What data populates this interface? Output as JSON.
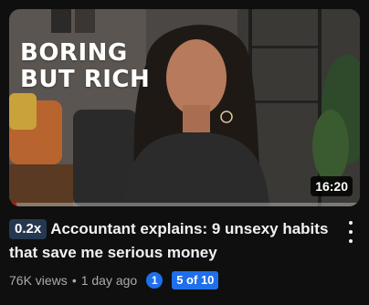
{
  "video": {
    "thumbnail_text_line1": "BORING",
    "thumbnail_text_line2": "BUT RICH",
    "duration": "16:20",
    "watch_progress_percent": 2,
    "playback_speed": "0.2x",
    "title": "Accountant explains: 9 unsexy habits that save me serious money",
    "views": "76K views",
    "separator": "•",
    "age": "1 day ago",
    "count_badge": "1",
    "position_badge": "5 of 10"
  },
  "icons": {
    "more": "kebab-vertical-icon"
  },
  "colors": {
    "background": "#0f0f0f",
    "progress": "#ff0000",
    "speed_badge_bg": "#263850",
    "blue_badge": "#1f6feb",
    "secondary_text": "#aaaaaa"
  }
}
